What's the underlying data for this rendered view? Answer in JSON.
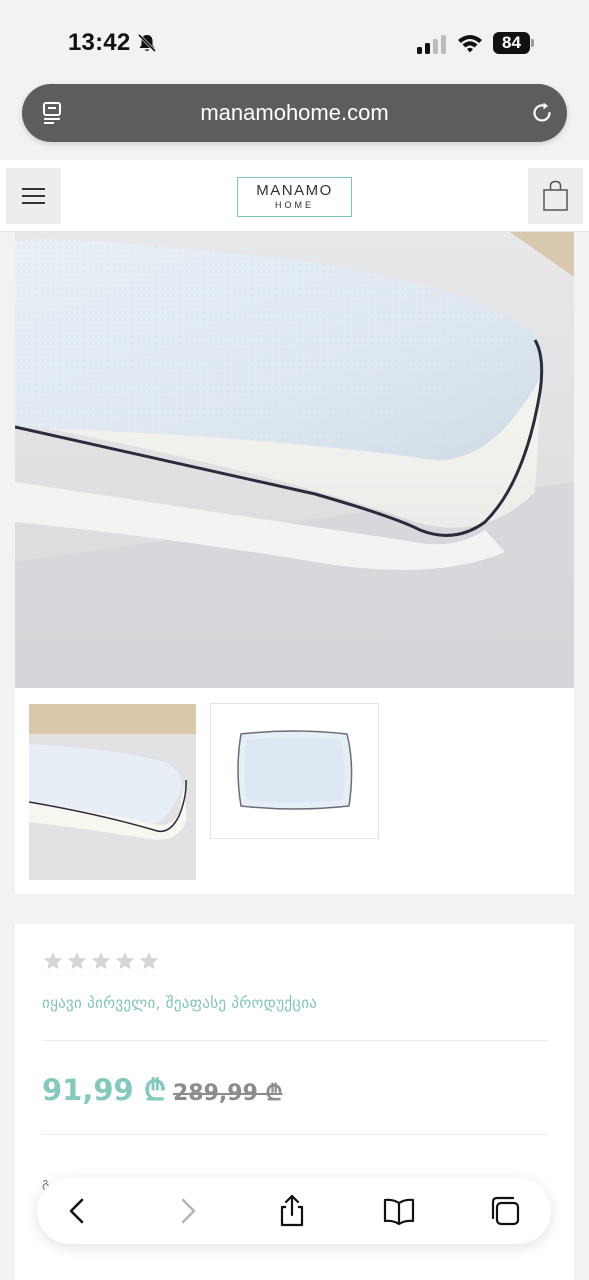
{
  "status_bar": {
    "time": "13:42",
    "battery": "84",
    "icons": [
      "bell-slash-icon",
      "signal-icon",
      "wifi-icon",
      "battery-icon"
    ]
  },
  "browser": {
    "url": "manamohome.com",
    "icons": [
      "reader-icon",
      "reload-icon"
    ]
  },
  "site_header": {
    "logo_main": "MANAMO",
    "logo_sub": "HOME",
    "icons": [
      "hamburger-menu-icon",
      "shopping-bag-icon"
    ]
  },
  "gallery": {
    "thumbnails": [
      "pillow-side-view",
      "pillow-top-view"
    ]
  },
  "product": {
    "rating": 0,
    "rating_max": 5,
    "review_prompt": "იყავი პირველი, შეაფასე პროდუქცია",
    "price_current": "91,99 ₾",
    "price_old": "289,99 ₾",
    "partial_label": "გ"
  },
  "toolbar": {
    "icons": [
      "back-icon",
      "forward-icon",
      "share-icon",
      "bookmarks-icon",
      "tabs-icon"
    ]
  },
  "colors": {
    "accent": "#84c9bd",
    "page_bg": "#f2f2f3",
    "url_bar_bg": "#5d5d60"
  }
}
